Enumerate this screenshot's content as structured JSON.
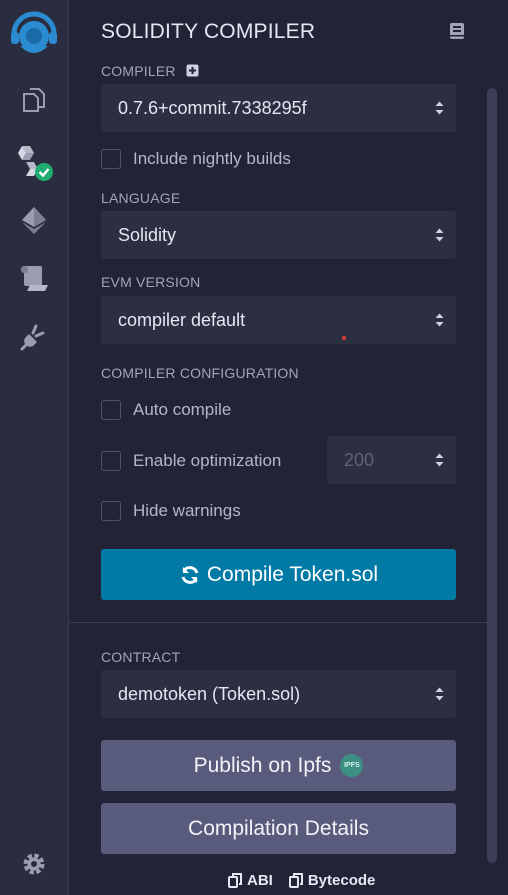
{
  "sidebar": {
    "icons": [
      "remix-logo-icon",
      "file-explorer-icon",
      "solidity-compiler-icon",
      "deploy-run-icon",
      "debugger-icon",
      "plugin-manager-icon",
      "settings-icon"
    ]
  },
  "panel": {
    "title": "SOLIDITY COMPILER"
  },
  "compiler": {
    "label": "COMPILER",
    "version": "0.7.6+commit.7338295f",
    "nightly_label": "Include nightly builds"
  },
  "language": {
    "label": "LANGUAGE",
    "value": "Solidity"
  },
  "evm": {
    "label": "EVM VERSION",
    "value": "compiler default"
  },
  "config": {
    "label": "COMPILER CONFIGURATION",
    "auto_compile": "Auto compile",
    "enable_optimization": "Enable optimization",
    "runs": "200",
    "hide_warnings": "Hide warnings"
  },
  "compile_button": "Compile Token.sol",
  "contract": {
    "label": "CONTRACT",
    "value": "demotoken (Token.sol)"
  },
  "publish_button": "Publish on Ipfs",
  "ipfs_badge": "IPFS",
  "details_button": "Compilation Details",
  "footer": {
    "abi": "ABI",
    "bytecode": "Bytecode"
  },
  "colors": {
    "accent": "#027aa6",
    "secondary_button": "#595b7d",
    "success": "#1fad71"
  }
}
